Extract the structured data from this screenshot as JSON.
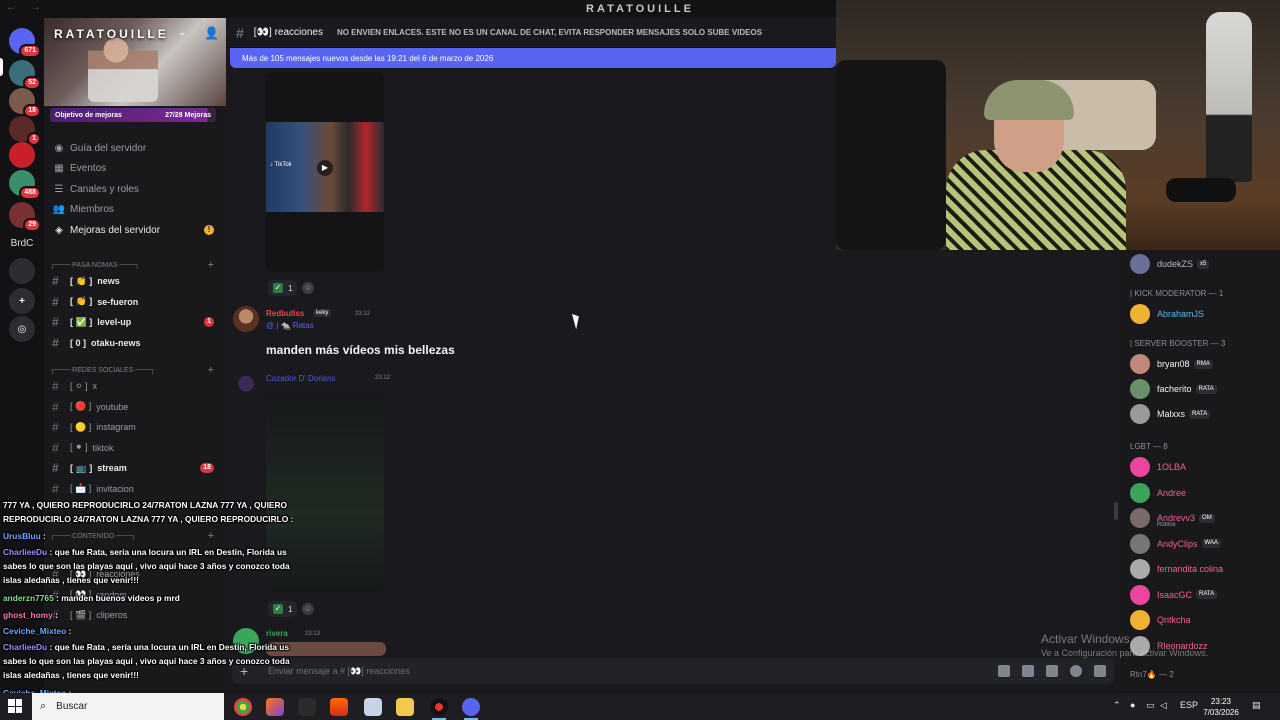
{
  "window": {
    "title": "RATATOUILLE",
    "nav_arrows": "← →"
  },
  "rail": {
    "servers": [
      {
        "label": "",
        "badge": "671",
        "color": "#5865f2"
      },
      {
        "label": "",
        "badge": "52",
        "color": "#3b6d7a"
      },
      {
        "label": "",
        "badge": "18",
        "color": "#7a5a4a"
      },
      {
        "label": "",
        "badge": "1",
        "color": "#5a2a2a"
      },
      {
        "label": "",
        "badge": "",
        "color": "#c8202a"
      },
      {
        "label": "",
        "badge": "488",
        "color": "#3a8f6a"
      },
      {
        "label": "",
        "badge": "29",
        "color": "#7a3030"
      },
      {
        "text": "BrdC"
      },
      {
        "label": "",
        "badge": "",
        "color": "#2b2d31"
      },
      {
        "label": "+",
        "badge": "",
        "color": "#2b2d31"
      },
      {
        "label": "◎",
        "badge": "",
        "color": "#2b2d31"
      }
    ]
  },
  "sidebar": {
    "server_name": "RATATOUILLE",
    "boost_goal_label": "Objetivo de mejoras",
    "boost_goal_value": "27/28 Mejoras",
    "menu": [
      {
        "label": "Guía del servidor",
        "icon": "compass-icon",
        "glyph": "◉"
      },
      {
        "label": "Eventos",
        "icon": "calendar-icon",
        "glyph": "▦"
      },
      {
        "label": "Canales y roles",
        "icon": "channels-icon",
        "glyph": "☰"
      },
      {
        "label": "Miembros",
        "icon": "members-icon",
        "glyph": "👥"
      },
      {
        "label": "Mejoras del servidor",
        "icon": "boost-icon",
        "glyph": "◈"
      }
    ],
    "categories": {
      "pasa_nomas": "┌───·PASA NOMAS·───┐",
      "redes": "┌───·REDES SOCIALES·───┐",
      "contenido": "┌───·CONTENIDO·───┐"
    },
    "channels_a": [
      {
        "name": "news",
        "prefix": "[ 👏 ]",
        "unread": true,
        "badge": ""
      },
      {
        "name": "se-fueron",
        "prefix": "[ 👏 ]",
        "unread": true,
        "badge": ""
      },
      {
        "name": "level-up",
        "prefix": "[ ✅ ]",
        "unread": true,
        "badge": "1"
      },
      {
        "name": "otaku-news",
        "prefix": "[ 0 ]",
        "unread": true,
        "badge": ""
      }
    ],
    "channels_b": [
      {
        "name": "x",
        "prefix": "[ ⚪ ]",
        "unread": false,
        "badge": ""
      },
      {
        "name": "youtube",
        "prefix": "[ 🔴 ]",
        "unread": false,
        "badge": ""
      },
      {
        "name": "instagram",
        "prefix": "[ 🟡 ]",
        "unread": false,
        "badge": ""
      },
      {
        "name": "tiktok",
        "prefix": "[ ⚫ ]",
        "unread": false,
        "badge": ""
      },
      {
        "name": "stream",
        "prefix": "[ 📺 ]",
        "unread": true,
        "badge": "18"
      },
      {
        "name": "invitacion",
        "prefix": "[ 📩 ]",
        "unread": false,
        "badge": ""
      }
    ],
    "channels_c": [
      {
        "name": "reacciones",
        "prefix": "[ 👀 ]"
      },
      {
        "name": "random",
        "prefix": "[ 👀 ]"
      },
      {
        "name": "cliperos",
        "prefix": "[ 🎬 ]"
      }
    ]
  },
  "header": {
    "channel": "[👀] reacciones",
    "topic": "NO ENVIEN ENLACES. ESTE NO ES UN CANAL DE CHAT, EVITA RESPONDER MENSAJES SOLO SUBE VIDEOS",
    "new_messages": "Más de 105 mensajes nuevos desde las 19:21 del 6 de marzo de 2026"
  },
  "messages": {
    "reaction_count": "1",
    "m1": {
      "user": "Redbullss",
      "tag": "keky",
      "time": "23:12",
      "reply_line": "@ | 🐀 Ratas",
      "text": "manden más vídeos mis bellezas"
    },
    "m2": {
      "user": "Cazador D' Dorians",
      "time": "23:12"
    },
    "m3": {
      "user": "rivera",
      "time": "23:13"
    }
  },
  "composer": {
    "placeholder": "Enviar mensaje a # [👀] reacciones"
  },
  "members": {
    "top_member": {
      "name": "dudekZS",
      "chip": "x5"
    },
    "kick_mod_header": "| KICK MODERATOR — 1",
    "kick_mods": [
      {
        "name": "AbrahamJS",
        "color": "#5cb4f0",
        "chip": ""
      }
    ],
    "booster_header": "| SERVER BOOSTER — 3",
    "boosters": [
      {
        "name": "bryan08",
        "color": "#f2f3f5",
        "chip": "RMA"
      },
      {
        "name": "facherito",
        "color": "#f2f3f5",
        "chip": "RATA"
      },
      {
        "name": "Malxxs",
        "color": "#f2f3f5",
        "chip": "RATA"
      }
    ],
    "lgbt_header": "LGBT — 8",
    "lgbt": [
      {
        "name": "1OLBA",
        "color": "#f06292",
        "chip": "",
        "sub": ""
      },
      {
        "name": "Andree",
        "color": "#f06292",
        "chip": "",
        "sub": ""
      },
      {
        "name": "Andrevv3",
        "color": "#f06292",
        "chip": "OM",
        "sub": "Roblox"
      },
      {
        "name": "AndyClips",
        "color": "#f06292",
        "chip": "WAA",
        "sub": ""
      },
      {
        "name": "fernandita colina",
        "color": "#f06292",
        "chip": "",
        "sub": ""
      },
      {
        "name": "IsaacGC",
        "color": "#f06292",
        "chip": "RATA",
        "sub": ""
      },
      {
        "name": "Qntkcha",
        "color": "#f06292",
        "chip": "",
        "sub": ""
      },
      {
        "name": "Rleonardozz",
        "color": "#f06292",
        "chip": "",
        "sub": ""
      }
    ],
    "rtn_header": "Rtn7🔥 — 2"
  },
  "overlay_chat": [
    {
      "user": "",
      "color": "#ffffff",
      "text": "777 YA , QUIERO REPRODUCIRLO 24/7RATON LAZNA 777 YA , QUIERO REPRODUCIRLO 24/7RATON LAZNA 777 YA , QUIERO REPRODUCIRLO :"
    },
    {
      "user": "UrusBluu",
      "color": "#6fa8ff",
      "text": ":"
    },
    {
      "user": "CharlieeDu",
      "color": "#a78bfa",
      "text": ": que fue Rata, sería una locura un IRL en Destin, Florida us sabes lo que son las playas aquí , vivo aquí hace 3 años y conozco toda islas aledañas , tienes que venir!!!"
    },
    {
      "user": "anderzn7765",
      "color": "#7ee787",
      "text": ": manden buenos videos p mrd"
    },
    {
      "user": "ghost_homy",
      "color": "#ff7ab6",
      "text": ":"
    },
    {
      "user": "Ceviche_Mixteo",
      "color": "#6fa8ff",
      "text": ":"
    },
    {
      "user": "CharlieeDu",
      "color": "#a78bfa",
      "text": ": que fue Rata , sería una locura un IRL en Destin, Florida us sabes lo que son las playas aquí , vivo aquí hace 3 años y conozco toda islas aledañas , tienes que venir!!!"
    },
    {
      "user": "Ceviche_Mixteo",
      "color": "#6fa8ff",
      "text": ":"
    }
  ],
  "watermark": {
    "line1": "Activar Windows",
    "line2": "Ve a Configuración para activar Windows."
  },
  "taskbar": {
    "search": "Buscar",
    "lang": "ESP",
    "time": "23:23",
    "date": "7/03/2026"
  }
}
